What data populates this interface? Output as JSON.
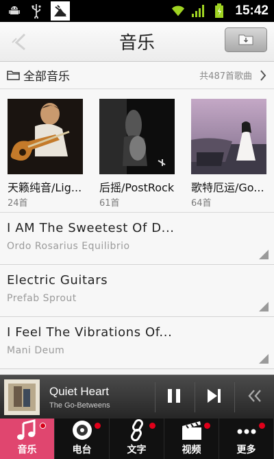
{
  "status_bar": {
    "time": "15:42",
    "icons": [
      "android-debug-icon",
      "usb-icon",
      "notification-icon",
      "wifi-icon",
      "signal-icon",
      "battery-icon"
    ]
  },
  "header": {
    "title": "音乐",
    "back_icon": "back-arrow-icon",
    "action_icon": "folder-icon"
  },
  "all_music": {
    "label": "全部音乐",
    "count": "共487首歌曲"
  },
  "albums": [
    {
      "name": "天籁纯音/Lig...",
      "count": "24首"
    },
    {
      "name": "后摇/PostRock",
      "count": "61首"
    },
    {
      "name": "歌特厄运/Go...",
      "count": "64首"
    }
  ],
  "songs": [
    {
      "title": "I AM The Sweetest Of D...",
      "artist": "Ordo Rosarius Equilibrio"
    },
    {
      "title": "Electric Guitars",
      "artist": "Prefab Sprout"
    },
    {
      "title": "I Feel The Vibrations Of...",
      "artist": "Mani Deum"
    }
  ],
  "now_playing": {
    "title": "Quiet Heart",
    "artist": "The Go-Betweens"
  },
  "tabs": [
    {
      "label": "音乐",
      "icon": "music-note-icon",
      "active": true
    },
    {
      "label": "电台",
      "icon": "radio-disc-icon",
      "active": false
    },
    {
      "label": "文字",
      "icon": "link-icon",
      "active": false
    },
    {
      "label": "视频",
      "icon": "clapperboard-icon",
      "active": false
    },
    {
      "label": "更多",
      "icon": "more-dots-icon",
      "active": false
    }
  ],
  "colors": {
    "accent": "#e0466f",
    "badge": "#e0001a",
    "statusbar": "#000000",
    "player_bg": "#333333"
  }
}
